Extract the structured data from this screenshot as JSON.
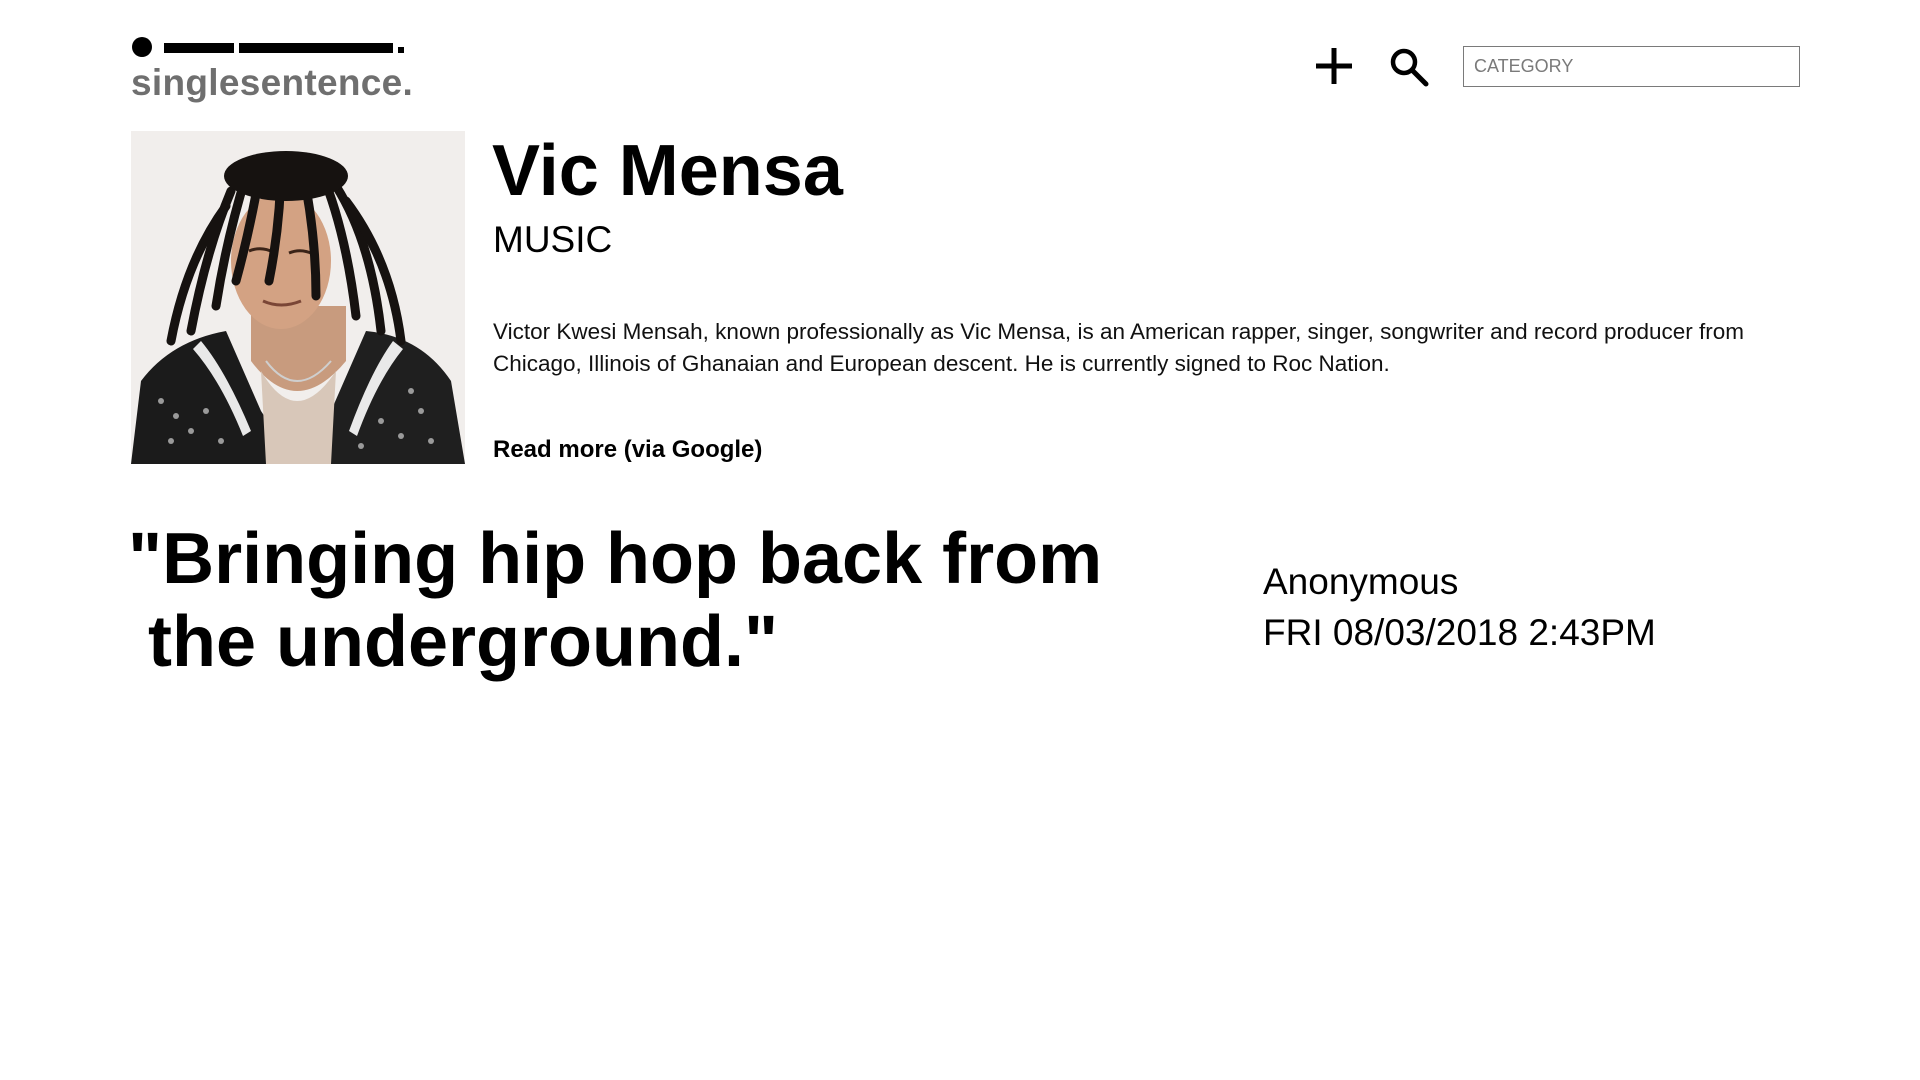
{
  "header": {
    "logo_text": "singlesentence.",
    "add_icon": "plus-icon",
    "search_icon": "search-icon",
    "category_placeholder": "CATEGORY"
  },
  "artist": {
    "name": "Vic Mensa",
    "category": "MUSIC",
    "description": "Victor Kwesi Mensah, known professionally as Vic Mensa, is an American rapper, singer, songwriter and record producer from Chicago, Illinois of Ghanaian and European descent. He is currently signed to Roc Nation.",
    "read_more_label": "Read more (via Google)"
  },
  "quote": {
    "text": "\"Bringing hip hop back from\n the underground.\"",
    "author": "Anonymous",
    "date": "FRI 08/03/2018 2:43PM"
  },
  "colors": {
    "logo_text": "#6f6f6f",
    "text": "#000000",
    "input_border": "#7a7a7a",
    "background": "#ffffff"
  }
}
